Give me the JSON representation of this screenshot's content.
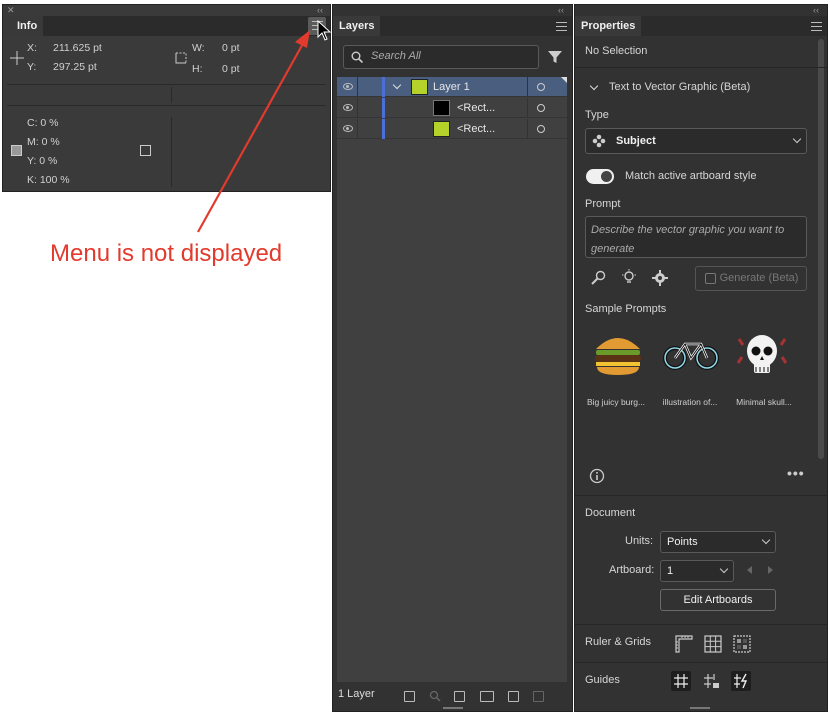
{
  "info": {
    "tab": "Info",
    "x_label": "X:",
    "x_value": "211.625 pt",
    "y_label": "Y:",
    "y_value": "297.25 pt",
    "w_label": "W:",
    "w_value": "0 pt",
    "h_label": "H:",
    "h_value": "0 pt",
    "c": "C: 0 %",
    "m": "M: 0 %",
    "yel": "Y: 0 %",
    "k": "K: 100 %"
  },
  "annotation": {
    "text": "Menu is not displayed",
    "color": "#e23a2c"
  },
  "layers": {
    "tab": "Layers",
    "search_placeholder": "Search All",
    "rows": [
      {
        "name": "Layer 1",
        "thumb": "#b5d22b",
        "selected": true
      },
      {
        "name": "<Rect...",
        "thumb": "#000000",
        "selected": false
      },
      {
        "name": "<Rect...",
        "thumb": "#b5d22b",
        "selected": false
      }
    ],
    "footer": "1 Layer",
    "layer_color": "#4a6fd8"
  },
  "properties": {
    "tab": "Properties",
    "no_selection": "No Selection",
    "section_title": "Text to Vector Graphic (Beta)",
    "type_label": "Type",
    "type_value": "Subject",
    "toggle_label": "Match active artboard style",
    "prompt_label": "Prompt",
    "prompt_placeholder": "Describe the vector graphic you want to generate",
    "generate_label": "Generate (Beta)",
    "sample_label": "Sample Prompts",
    "samples": [
      {
        "caption": "Big juicy burg..."
      },
      {
        "caption": "illustration of..."
      },
      {
        "caption": "Minimal skull..."
      }
    ],
    "document_label": "Document",
    "units_label": "Units:",
    "units_value": "Points",
    "artboard_label": "Artboard:",
    "artboard_value": "1",
    "edit_artboards": "Edit Artboards",
    "ruler_label": "Ruler & Grids",
    "guides_label": "Guides"
  }
}
